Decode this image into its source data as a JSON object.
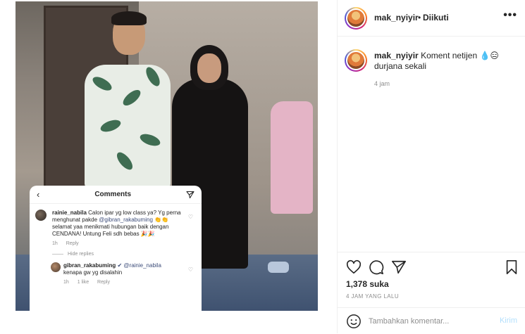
{
  "post_header": {
    "username": "mak_nyiyir",
    "separator": "•",
    "follow_status": "Diikuti",
    "more_label": "•••"
  },
  "caption": {
    "username": "mak_nyiyir",
    "text": "Koment netijen 💧😑 durjana sekali",
    "time": "4 jam"
  },
  "photo_overlay": {
    "title": "Comments",
    "back_icon": "chevron-left-icon",
    "send_icon": "send-icon",
    "comment1": {
      "username": "rainie_nabila",
      "text_before": " Calon ipar yg low class ya? Yg perna menghunat pakde ",
      "mention": "@gibran_rakabuming",
      "text_after": " 👏👏 selamat yaa menikmati hubungan baik dengan CENDANA! Untung  Feli sdh bebas 🎉🎉",
      "time": "1h",
      "reply": "Reply"
    },
    "hide_replies": "Hide replies",
    "comment2": {
      "username": "gibran_rakabuming",
      "verified": "✔",
      "mention": "@rainie_nabila",
      "text": "kenapa gw yg disalahin",
      "time": "1h",
      "likes": "1 like",
      "reply": "Reply"
    }
  },
  "actions": {
    "likes": "1,378 suka",
    "post_time": "4 JAM YANG LALU"
  },
  "add_comment": {
    "placeholder": "Tambahkan komentar...",
    "post_label": "Kirim"
  },
  "colors": {
    "link": "#3d4d7a",
    "secondary": "#8e8e8e",
    "post_disabled": "#b2dffc",
    "border": "#efefef"
  }
}
